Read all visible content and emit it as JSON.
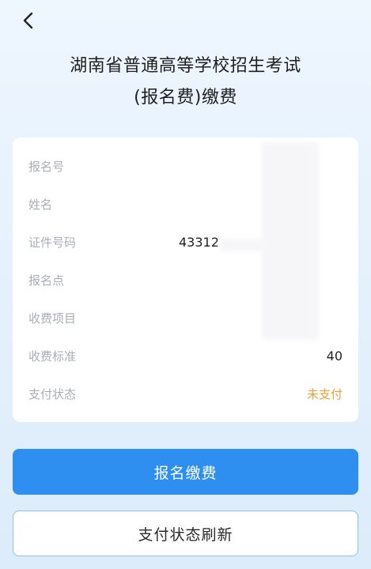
{
  "header": {
    "title_line1": "湖南省普通高等学校招生考试",
    "title_line2": "(报名费)缴费"
  },
  "info": {
    "rows": [
      {
        "label": "报名号",
        "value": ""
      },
      {
        "label": "姓名",
        "value": ""
      },
      {
        "label": "证件号码",
        "value": "43312"
      },
      {
        "label": "报名点",
        "value": ""
      },
      {
        "label": "收费项目",
        "value": ""
      },
      {
        "label": "收费标准",
        "value": "40"
      },
      {
        "label": "支付状态",
        "value": "未支付"
      }
    ],
    "status_color": "#e6a23c"
  },
  "actions": {
    "pay_label": "报名缴费",
    "refresh_label": "支付状态刷新"
  },
  "colors": {
    "primary": "#2e8ff0",
    "outline_border": "#8cc0ee"
  }
}
